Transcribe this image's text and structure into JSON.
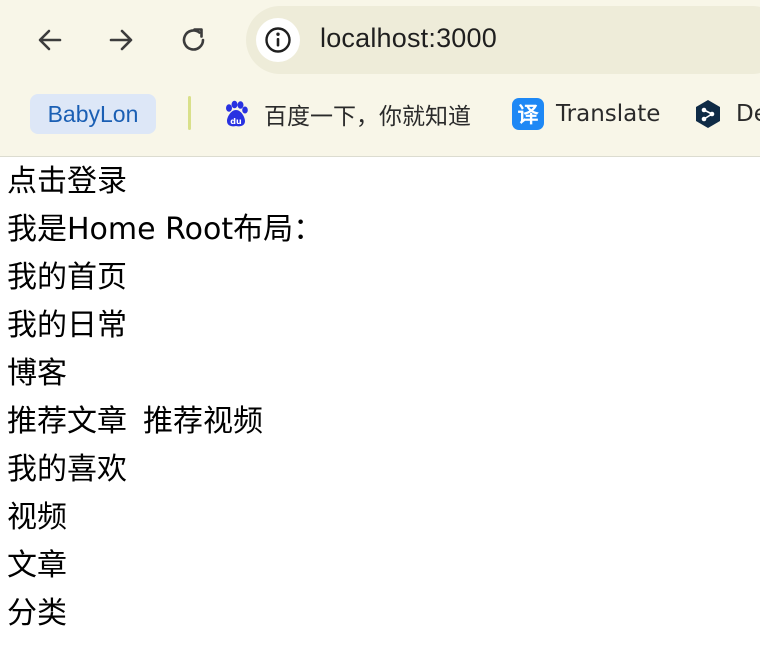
{
  "browser": {
    "url": "localhost:3000",
    "bookmarks": {
      "folder": "BabyLon",
      "baidu": "百度一下，你就知道",
      "translate": "Translate",
      "translate_glyph": "译",
      "deepl": "De"
    },
    "icons": {
      "back": "back-arrow-icon",
      "forward": "forward-arrow-icon",
      "reload": "reload-icon",
      "info": "info-icon",
      "baidu": "baidu-paw-icon",
      "translate": "translate-icon",
      "deepl": "deepl-icon"
    },
    "colors": {
      "toolbar_bg": "#f8f6e8",
      "omnibox_bg": "#eeecd9",
      "folder_bg": "#dde7f7",
      "folder_text": "#1a5fb4",
      "baidu_blue": "#2932e1",
      "translate_blue": "#1e88f5",
      "deepl_navy": "#0f2b46"
    }
  },
  "page": {
    "login_link": "点击登录",
    "layout_heading": "我是Home Root布局：",
    "home_link": "我的首页",
    "daily_link": "我的日常",
    "blog_link": "博客",
    "recommend_articles": "推荐文章",
    "recommend_videos": "推荐视频",
    "likes_link": "我的喜欢",
    "videos_link": "视频",
    "articles_link": "文章",
    "category_link": "分类"
  }
}
